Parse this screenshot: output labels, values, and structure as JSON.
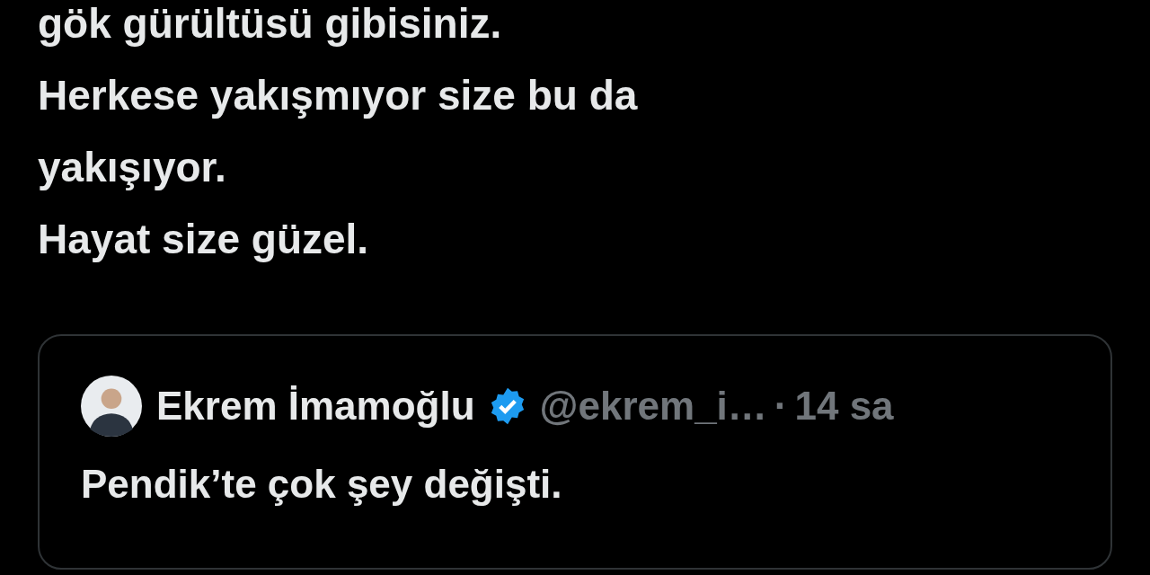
{
  "post": {
    "lines": [
      "gök gürültüsü gibisiniz.",
      "Herkese yakışmıyor size bu da",
      "yakışıyor.",
      "Hayat size güzel."
    ]
  },
  "quoted_post": {
    "author": {
      "name": "Ekrem İmamoğlu",
      "verified": true,
      "handle": "@ekrem_i…",
      "separator": "·",
      "time": "14 sa"
    },
    "text": "Pendik’te çok şey değişti."
  }
}
